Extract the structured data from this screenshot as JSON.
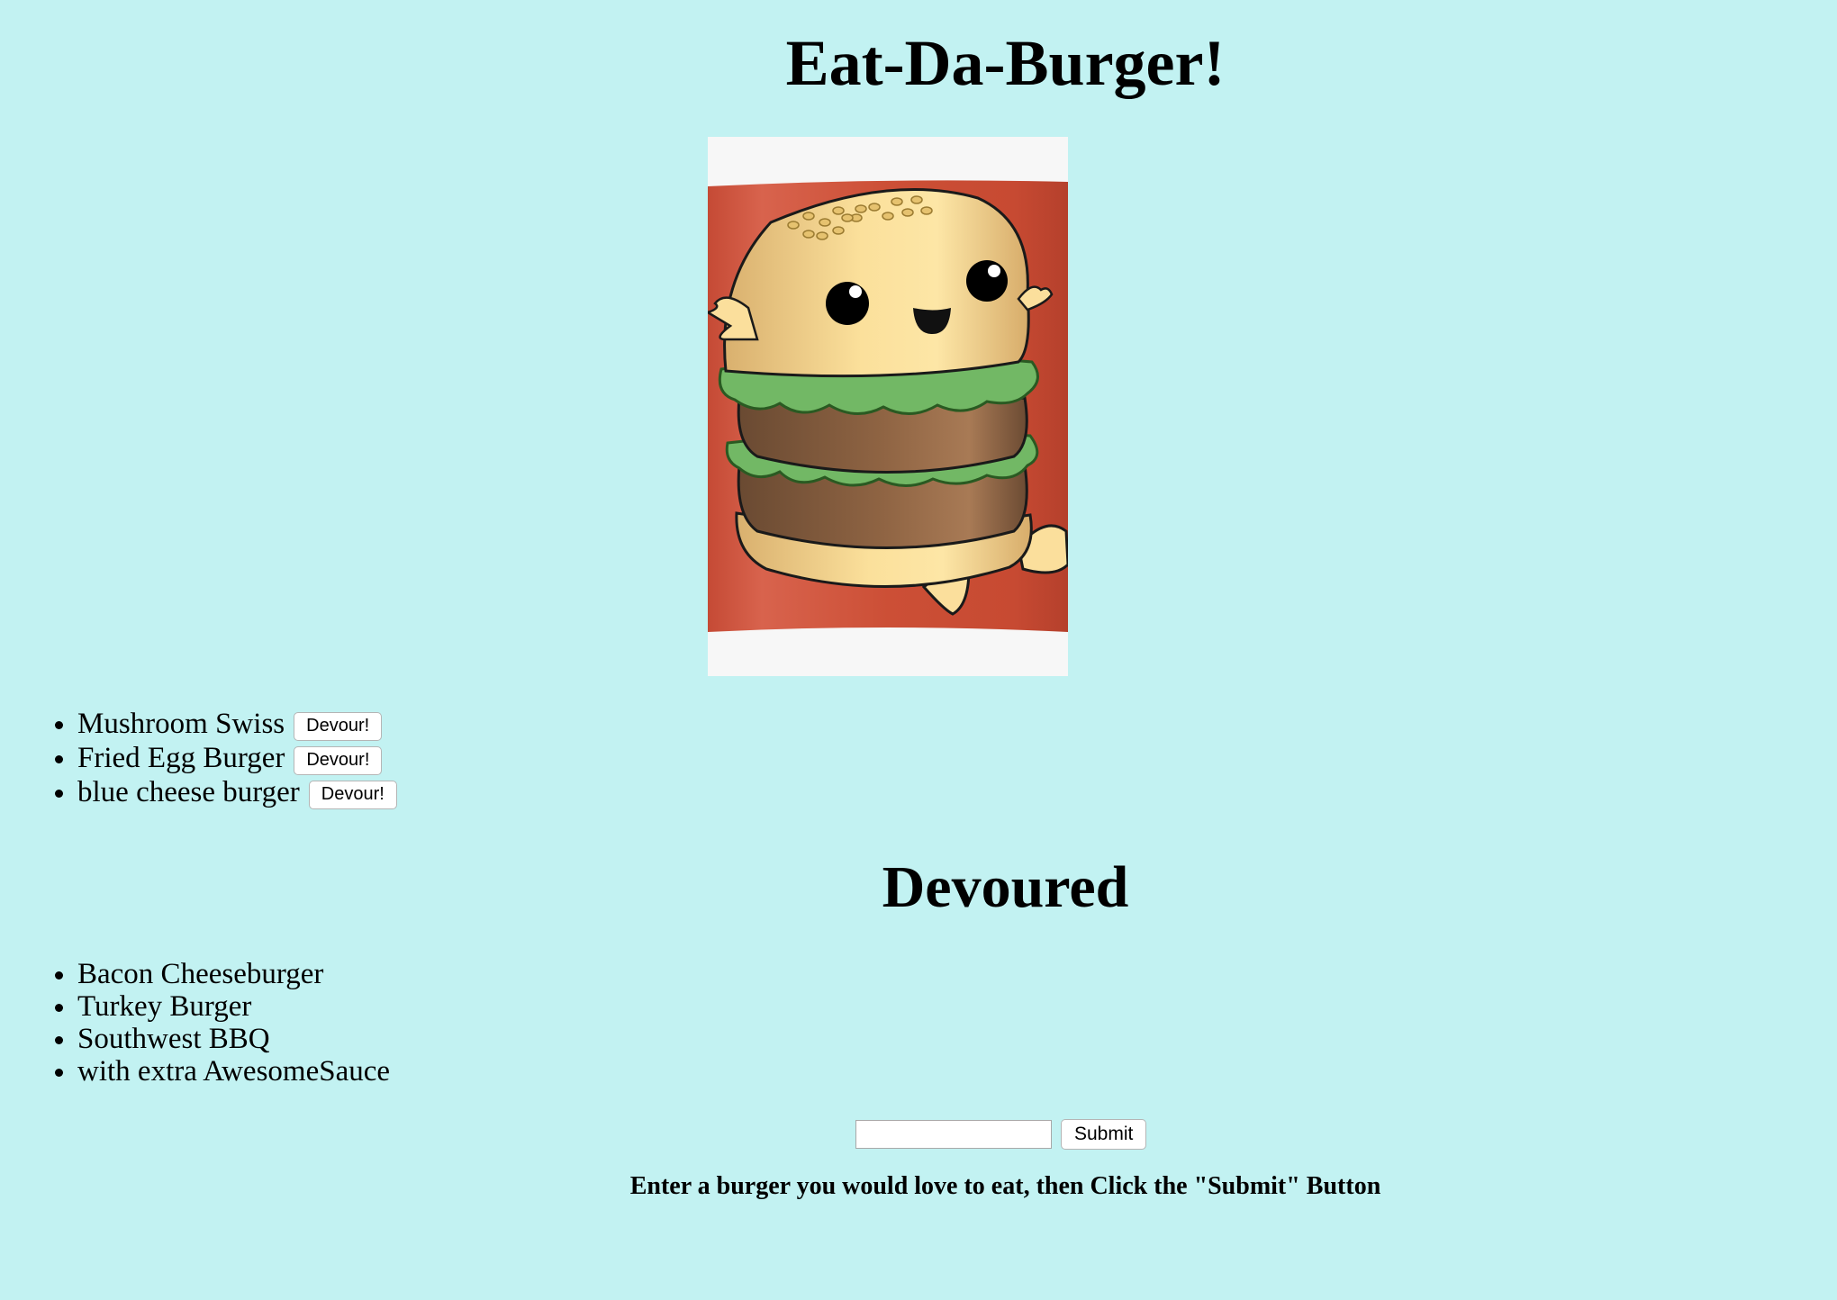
{
  "header": {
    "title": "Eat-Da-Burger!"
  },
  "hero_image": {
    "icon": "burger-mascot-image"
  },
  "to_eat": {
    "button_label": "Devour!",
    "items": [
      {
        "name": "Mushroom Swiss"
      },
      {
        "name": "Fried Egg Burger"
      },
      {
        "name": "blue cheese burger"
      }
    ]
  },
  "devoured": {
    "title": "Devoured",
    "items": [
      {
        "name": "Bacon Cheeseburger"
      },
      {
        "name": "Turkey Burger"
      },
      {
        "name": "Southwest BBQ"
      },
      {
        "name": "with extra AwesomeSauce"
      }
    ]
  },
  "form": {
    "input_value": "",
    "submit_label": "Submit",
    "hint": "Enter a burger you would love to eat, then Click the \"Submit\" Button"
  },
  "colors": {
    "background": "#c2f2f2"
  }
}
